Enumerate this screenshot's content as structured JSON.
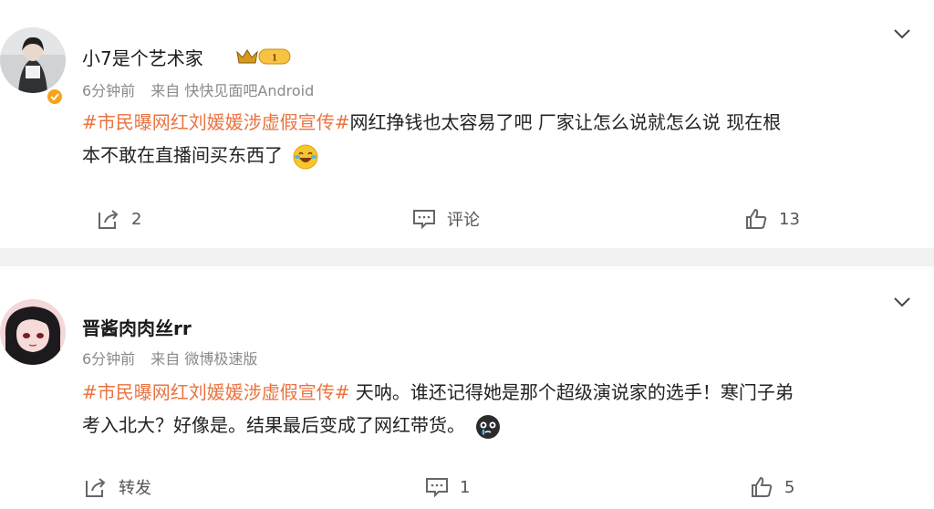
{
  "posts": [
    {
      "username": "小7是个艺术家",
      "badge_text": "1",
      "time": "6分钟前",
      "source": "来自 快快见面吧Android",
      "content_line1_hashtag": "#市民曝网红刘媛媛涉虚假宣传#",
      "content_line1_text": "网红挣钱也太容易了吧 厂家让怎么说就怎么说 现在根",
      "content_line2_text": "本不敢在直播间买东西了",
      "emoji": "laugh-cry-emoji",
      "forward_count": "2",
      "comment_label": "评论",
      "like_count": "13"
    },
    {
      "username": "晋酱肉肉丝rr",
      "time": "6分钟前",
      "source": "来自 微博极速版",
      "content_line1_hashtag": "#市民曝网红刘媛媛涉虚假宣传#",
      "content_line1_text": " 天呐。谁还记得她是那个超级演说家的选手！寒门子弟",
      "content_line2_text": "考入北大？好像是。结果最后变成了网红带货。",
      "emoji": "crying-emoji",
      "forward_label": "转发",
      "comment_count": "1",
      "like_count": "5"
    }
  ],
  "colors": {
    "hashtag": "#eb7340",
    "meta": "#8a8a8a",
    "separator": "#f2f2f2",
    "verified": "#f7a21a"
  }
}
